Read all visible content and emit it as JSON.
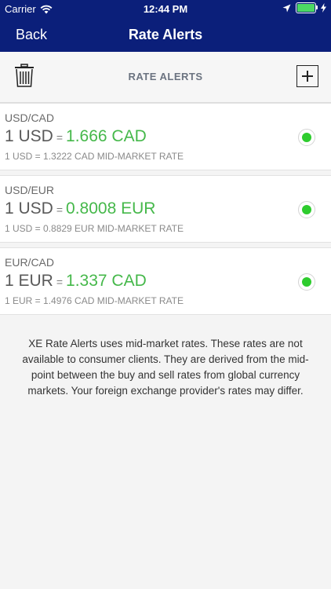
{
  "status_bar": {
    "carrier": "Carrier",
    "time": "12:44 PM"
  },
  "nav": {
    "back_label": "Back",
    "title": "Rate Alerts"
  },
  "toolbar": {
    "label": "RATE ALERTS"
  },
  "alerts": [
    {
      "pair": "USD/CAD",
      "base": "1 USD",
      "equals": "=",
      "target": "1.666 CAD",
      "midmarket": "1 USD = 1.3222 CAD MID-MARKET RATE",
      "active": true
    },
    {
      "pair": "USD/EUR",
      "base": "1 USD",
      "equals": "=",
      "target": "0.8008 EUR",
      "midmarket": "1 USD = 0.8829 EUR MID-MARKET RATE",
      "active": true
    },
    {
      "pair": "EUR/CAD",
      "base": "1 EUR",
      "equals": "=",
      "target": "1.337 CAD",
      "midmarket": "1 EUR = 1.4976 CAD MID-MARKET RATE",
      "active": true
    }
  ],
  "disclaimer": "XE Rate Alerts uses mid-market rates. These rates are not available to consumer clients. They are derived from the mid-point between the buy and sell rates from global currency markets. Your foreign exchange provider's rates may differ.",
  "colors": {
    "nav_background": "#0b1f7a",
    "target_rate": "#45b84a",
    "active_dot": "#2ecc2e"
  }
}
